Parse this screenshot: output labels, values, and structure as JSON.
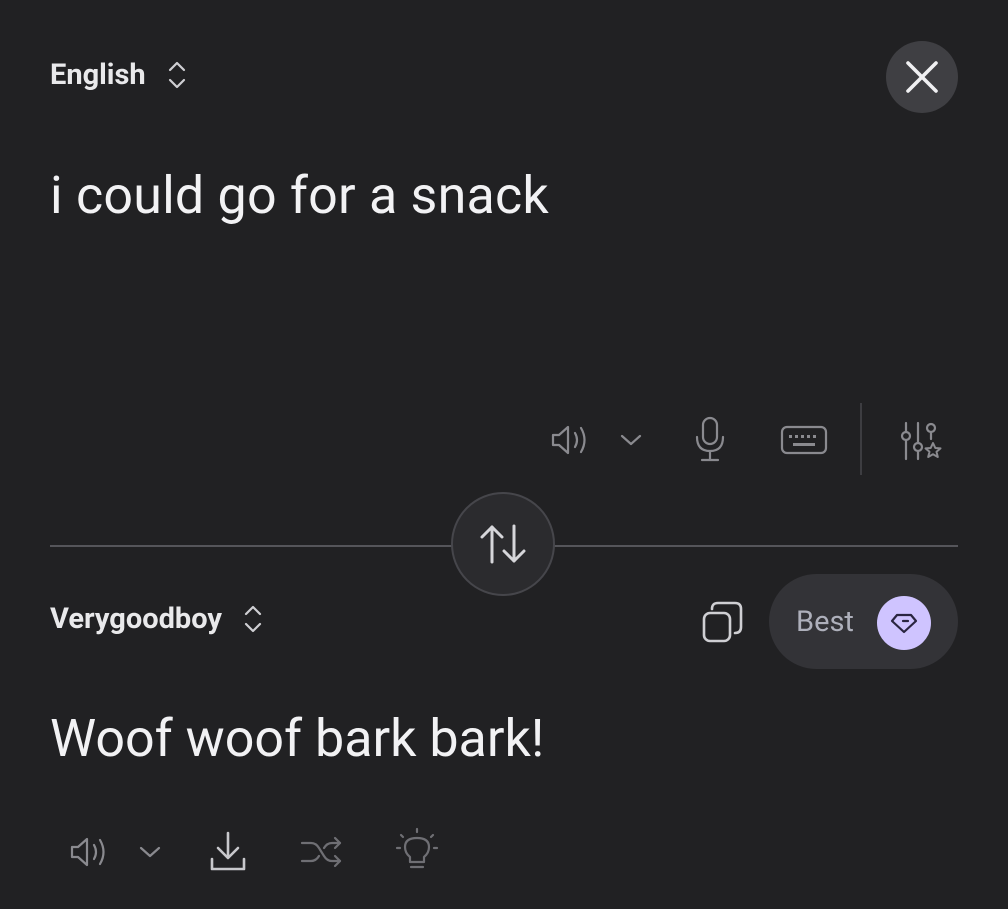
{
  "source": {
    "language": "English",
    "text": "i could go for a snack"
  },
  "target": {
    "language": "Verygoodboy",
    "text": "Woof woof bark bark!"
  },
  "quality": {
    "label": "Best"
  },
  "icons": {
    "close": "close-icon",
    "language_switch": "chevron-up-down-icon",
    "speaker": "speaker-icon",
    "voice_dropdown": "chevron-down-icon",
    "microphone": "microphone-icon",
    "keyboard": "keyboard-icon",
    "settings": "sliders-star-icon",
    "swap": "swap-arrows-icon",
    "copy": "copy-icon",
    "premium": "gem-icon",
    "download": "download-icon",
    "shuffle": "shuffle-icon",
    "idea": "lightbulb-icon"
  },
  "colors": {
    "background": "#212123",
    "accent": "#cfc4ff",
    "text": "#f2f2f4",
    "muted_icon": "#8a8a8f"
  }
}
